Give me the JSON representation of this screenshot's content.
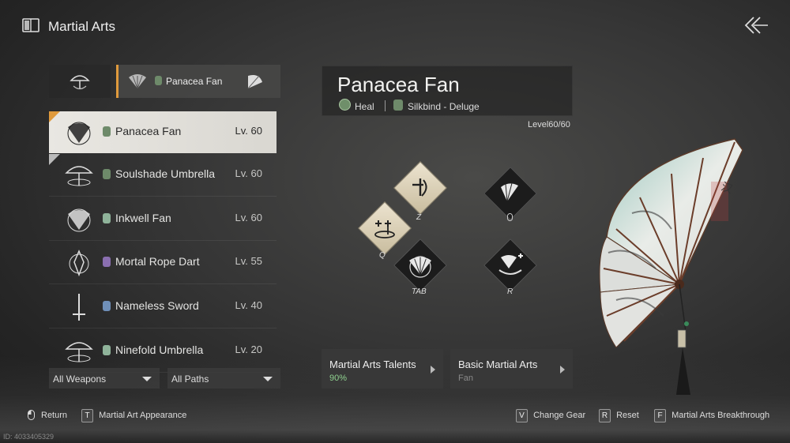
{
  "header": {
    "title": "Martial Arts"
  },
  "weapon_tab": {
    "label": "Panacea Fan"
  },
  "weapons": [
    {
      "name": "Panacea Fan",
      "level": "Lv. 60",
      "path_color": "#6e8a6a",
      "selected": true
    },
    {
      "name": "Soulshade Umbrella",
      "level": "Lv. 60",
      "path_color": "#6e8a6a",
      "selected": false
    },
    {
      "name": "Inkwell Fan",
      "level": "Lv. 60",
      "path_color": "#8fb39a",
      "selected": false
    },
    {
      "name": "Mortal Rope Dart",
      "level": "Lv. 55",
      "path_color": "#8a6fb0",
      "selected": false
    },
    {
      "name": "Nameless Sword",
      "level": "Lv. 40",
      "path_color": "#6f8fb8",
      "selected": false
    },
    {
      "name": "Ninefold Umbrella",
      "level": "Lv. 20",
      "path_color": "#8fb39a",
      "selected": false
    }
  ],
  "filters": {
    "weapons": "All Weapons",
    "paths": "All Paths"
  },
  "detail": {
    "title": "Panacea Fan",
    "role": "Heal",
    "path": "Silkbind - Deluge",
    "level": "Level60/60"
  },
  "skills": {
    "z": "Z",
    "q": "Q",
    "tab": "TAB",
    "r": "R"
  },
  "panels": {
    "talents": {
      "title": "Martial Arts Talents",
      "sub": "90%"
    },
    "basic": {
      "title": "Basic Martial Arts",
      "sub": "Fan"
    }
  },
  "footer": {
    "return": "Return",
    "appearance_key": "T",
    "appearance": "Martial Art Appearance",
    "change_gear_key": "V",
    "change_gear": "Change Gear",
    "reset_key": "R",
    "reset": "Reset",
    "breakthrough_key": "F",
    "breakthrough": "Martial Arts Breakthrough"
  },
  "uid": "ID: 4033405329",
  "colors": {
    "accent": "#e09a3c",
    "talent_green": "#8fd18f"
  }
}
